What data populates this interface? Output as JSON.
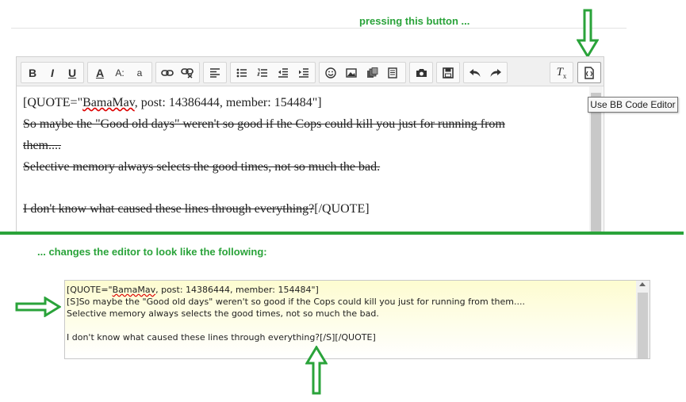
{
  "captions": {
    "top": "pressing this button ...",
    "middle": "... changes the editor to look like the following:"
  },
  "toolbar": {
    "buttons": [
      {
        "name": "bold-button",
        "icon": "bold-icon",
        "glyph": "B"
      },
      {
        "name": "italic-button",
        "icon": "italic-icon",
        "glyph": "I"
      },
      {
        "name": "underline-button",
        "icon": "underline-icon",
        "glyph": "U"
      },
      {
        "name": "font-color-button",
        "icon": "font-color-icon",
        "glyph": "A"
      },
      {
        "name": "font-size-button",
        "icon": "font-size-icon",
        "glyph": "A:"
      },
      {
        "name": "font-family-button",
        "icon": "font-family-icon",
        "glyph": "a"
      },
      {
        "name": "link-button",
        "icon": "link-icon"
      },
      {
        "name": "unlink-button",
        "icon": "unlink-icon"
      },
      {
        "name": "align-button",
        "icon": "align-left-icon"
      },
      {
        "name": "bullet-list-button",
        "icon": "bullet-list-icon"
      },
      {
        "name": "numbered-list-button",
        "icon": "numbered-list-icon"
      },
      {
        "name": "outdent-button",
        "icon": "outdent-icon"
      },
      {
        "name": "indent-button",
        "icon": "indent-icon"
      },
      {
        "name": "smilies-button",
        "icon": "smiley-icon"
      },
      {
        "name": "insert-image-button",
        "icon": "image-icon"
      },
      {
        "name": "media-button",
        "icon": "media-icon"
      },
      {
        "name": "code-button",
        "icon": "code-icon"
      },
      {
        "name": "screenshot-button",
        "icon": "camera-icon"
      },
      {
        "name": "save-draft-button",
        "icon": "save-icon"
      },
      {
        "name": "undo-button",
        "icon": "undo-icon"
      },
      {
        "name": "redo-button",
        "icon": "redo-icon"
      },
      {
        "name": "remove-format-button",
        "icon": "remove-format-icon",
        "glyph": "T"
      },
      {
        "name": "bbcode-toggle-button",
        "icon": "bbcode-editor-icon"
      }
    ],
    "tooltip": "Use BB Code Editor"
  },
  "rich_editor": {
    "line1_prefix": "[QUOTE=\"",
    "line1_name": "BamaMav",
    "line1_suffix": ", post: 14386444, member: 154484\"]",
    "line2": "So maybe the \"Good old days\" weren't so good if the Cops could kill you just for running from",
    "line3": "them....",
    "line4": "Selective memory always selects the good times, not so much the bad.",
    "line5_strike": "I don't know what caused these lines through everything?",
    "line5_tail": "[/QUOTE]"
  },
  "bb_editor": {
    "line1_prefix": "[QUOTE=\"",
    "line1_name": "BamaMav",
    "line1_suffix": ", post: 14386444, member: 154484\"]",
    "line2": "[S]So maybe the \"Good old days\" weren't so good if the Cops could kill you just for running from them....",
    "line3": "Selective memory always selects the good times, not so much the bad.",
    "line4": "",
    "line5": "I don't know what caused these lines through everything?[/S][/QUOTE]"
  },
  "colors": {
    "accent_green": "#2aa33a",
    "bb_background": "#fdfcd0"
  }
}
